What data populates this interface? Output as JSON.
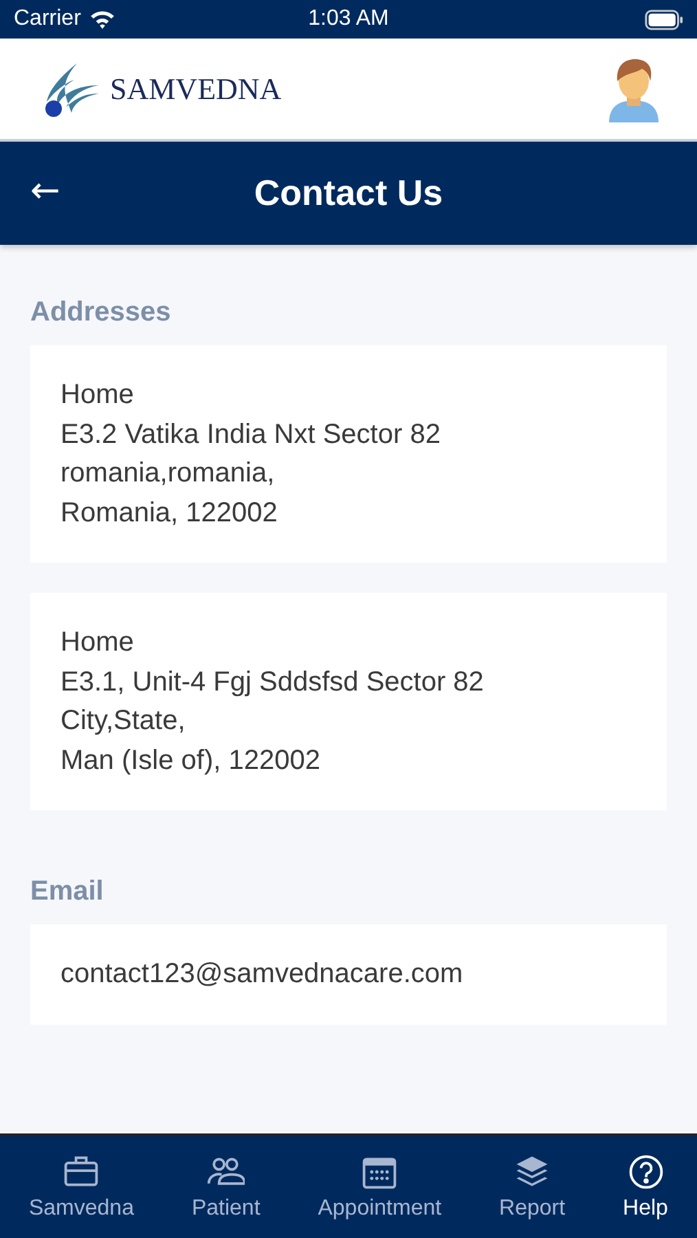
{
  "status_bar": {
    "carrier": "Carrier",
    "time": "1:03 AM"
  },
  "header": {
    "logo_text": "SAMVEDNA"
  },
  "title_bar": {
    "back": "←",
    "title": "Contact Us"
  },
  "sections": [
    {
      "heading": "Addresses",
      "cards": [
        {
          "lines": [
            "Home",
            "E3.2 Vatika India Nxt Sector 82",
            "romania,romania,",
            "Romania, 122002"
          ]
        },
        {
          "lines": [
            "Home",
            "E3.1, Unit-4 Fgj Sddsfsd Sector 82",
            "City,State,",
            "Man (Isle of), 122002"
          ]
        }
      ]
    },
    {
      "heading": "Email",
      "cards": [
        {
          "lines": [
            "contact123@samvednacare.com"
          ]
        }
      ]
    }
  ],
  "tabs": [
    {
      "label": "Samvedna",
      "kind": "briefcase",
      "selected": false
    },
    {
      "label": "Patient",
      "kind": "people",
      "selected": false
    },
    {
      "label": "Appointment",
      "kind": "calendar",
      "selected": false
    },
    {
      "label": "Report",
      "kind": "layers",
      "selected": false
    },
    {
      "label": "Help",
      "kind": "help",
      "selected": true
    }
  ]
}
